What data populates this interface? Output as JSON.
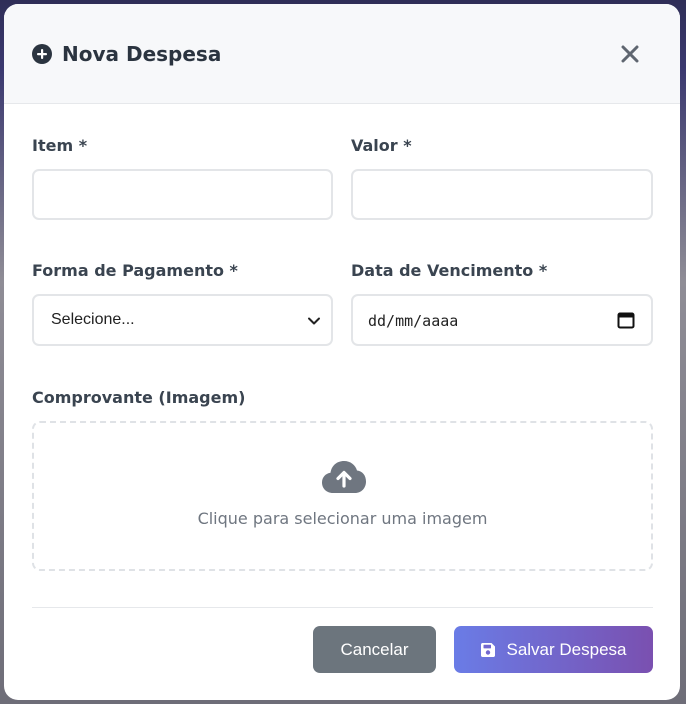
{
  "modal": {
    "title": "Nova Despesa",
    "icons": {
      "title": "plus-circle-icon",
      "close": "close-icon"
    }
  },
  "form": {
    "item_label": "Item *",
    "item_value": "",
    "valor_label": "Valor *",
    "valor_value": "",
    "pagamento_label": "Forma de Pagamento *",
    "pagamento_selected": "Selecione...",
    "vencimento_label": "Data de Vencimento *",
    "vencimento_placeholder": "dd/mm/aaaa",
    "comprovante_label": "Comprovante (Imagem)",
    "upload_text": "Clique para selecionar uma imagem",
    "upload_icon": "cloud-upload-icon"
  },
  "actions": {
    "cancel_label": "Cancelar",
    "save_label": "Salvar Despesa",
    "save_icon": "floppy-disk-icon"
  },
  "colors": {
    "cancel_bg": "#6c757d",
    "save_gradient_start": "#6a7ce6",
    "save_gradient_end": "#7a50b0",
    "title_text": "#2b3440"
  }
}
